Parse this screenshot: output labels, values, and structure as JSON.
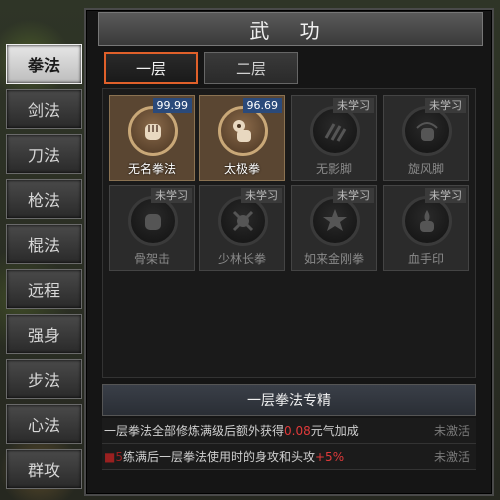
{
  "title": "武 功",
  "left_tabs": [
    {
      "label": "拳法",
      "active": true
    },
    {
      "label": "剑法",
      "active": false
    },
    {
      "label": "刀法",
      "active": false
    },
    {
      "label": "枪法",
      "active": false
    },
    {
      "label": "棍法",
      "active": false
    },
    {
      "label": "远程",
      "active": false
    },
    {
      "label": "强身",
      "active": false
    },
    {
      "label": "步法",
      "active": false
    },
    {
      "label": "心法",
      "active": false
    },
    {
      "label": "群攻",
      "active": false
    }
  ],
  "layer_tabs": [
    {
      "label": "一层",
      "active": true
    },
    {
      "label": "二层",
      "active": false
    }
  ],
  "skills": [
    {
      "name": "无名拳法",
      "badge": "99.99",
      "learned": true,
      "icon": "fist-icon"
    },
    {
      "name": "太极拳",
      "badge": "96.69",
      "learned": true,
      "icon": "yinyang-fist-icon"
    },
    {
      "name": "无影脚",
      "badge": "未学习",
      "learned": false,
      "icon": "claw-icon"
    },
    {
      "name": "旋风脚",
      "badge": "未学习",
      "learned": false,
      "icon": "whirlwind-fist-icon"
    },
    {
      "name": "骨架击",
      "badge": "未学习",
      "learned": false,
      "icon": "fist-icon"
    },
    {
      "name": "少林长拳",
      "badge": "未学习",
      "learned": false,
      "icon": "crossbones-icon"
    },
    {
      "name": "如来金刚拳",
      "badge": "未学习",
      "learned": false,
      "icon": "burst-fist-icon"
    },
    {
      "name": "血手印",
      "badge": "未学习",
      "learned": false,
      "icon": "blood-fist-icon"
    }
  ],
  "mastery": {
    "header": "一层拳法专精",
    "row1": {
      "text_a": "一层拳法全部修炼满级后额外获得",
      "value": "0.08",
      "text_b": "元气加成",
      "status": "未激活"
    },
    "row2": {
      "prefix": "■5",
      "text": "练满后一层拳法使用时的身攻和头攻",
      "value": "+5%",
      "status": "未激活"
    }
  },
  "colors": {
    "active_tab_border": "#e0602a",
    "learned_badge": "#2b4a7a",
    "highlight_red": "#e03a3a"
  }
}
